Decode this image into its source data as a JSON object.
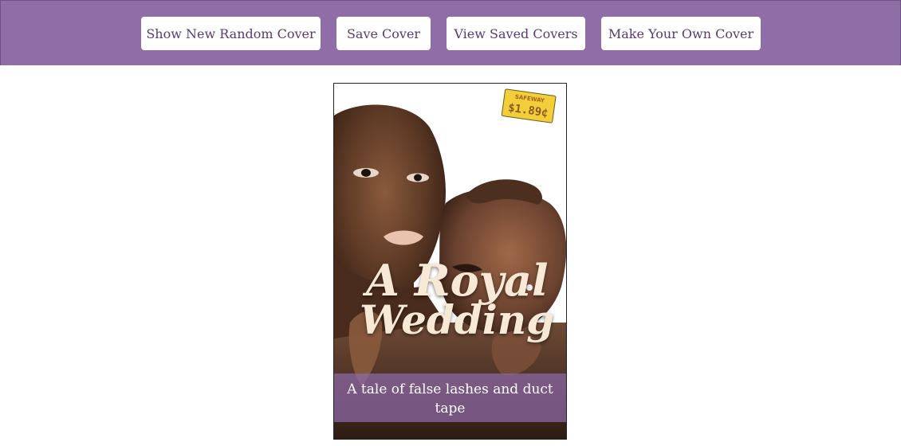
{
  "header": {
    "buttons": {
      "random": "Show New Random Cover",
      "save": "Save Cover",
      "view": "View Saved Covers",
      "make": "Make Your Own Cover"
    }
  },
  "cover": {
    "title_line1": "A Royal",
    "title_line2": "Wedding",
    "tagline": "A tale of false lashes and duct tape",
    "price_sticker": {
      "store": "SAFEWAY",
      "price": "$1.89¢"
    }
  },
  "colors": {
    "header_bg": "#8f6ea8",
    "button_text": "#5a3b6f",
    "tagline_bar": "#8c6aa8",
    "title_text": "#f7e9d6"
  }
}
